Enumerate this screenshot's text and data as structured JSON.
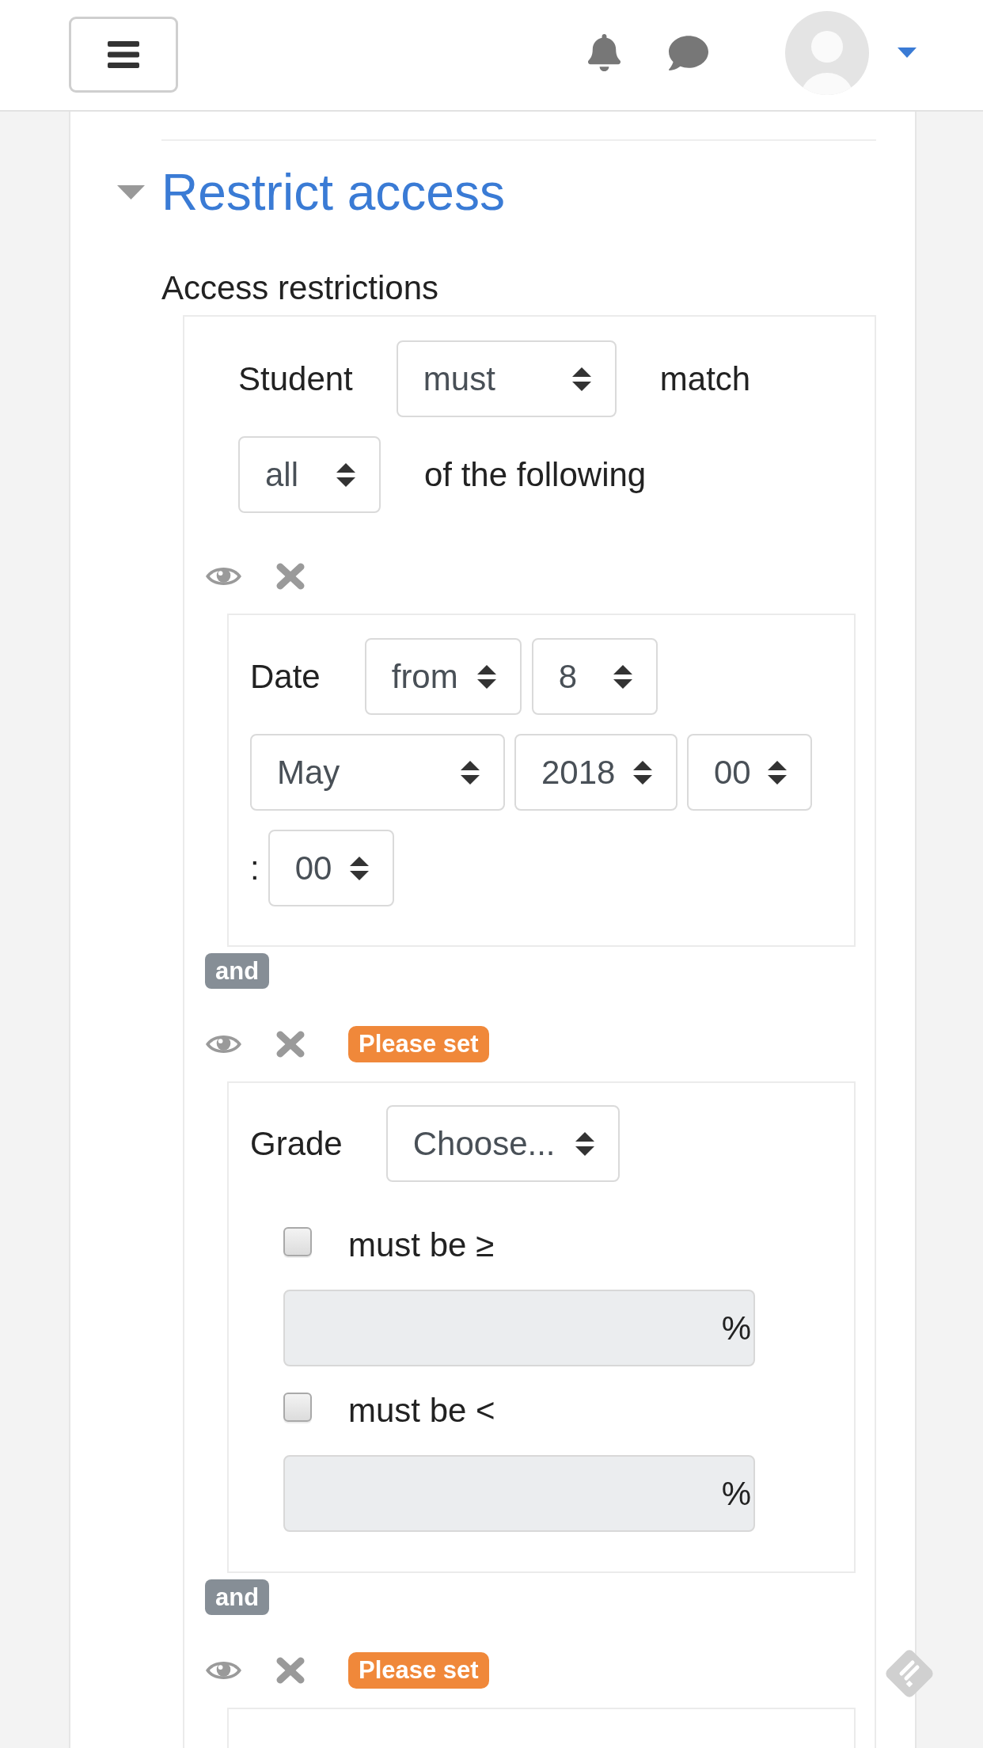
{
  "section": {
    "title": "Restrict access",
    "expanded": true
  },
  "restrictions": {
    "label": "Access restrictions",
    "match_row": {
      "prefix": "Student",
      "select": "must",
      "suffix": "match"
    },
    "scope_row": {
      "select": "all",
      "suffix": "of the following"
    },
    "conditions": [
      {
        "kind": "date",
        "label": "Date",
        "direction": "from",
        "day": "8",
        "month": "May",
        "year": "2018",
        "hour": "00",
        "separator": ":",
        "minute": "00",
        "joiner": "and"
      },
      {
        "kind": "grade",
        "warning": "Please set",
        "label": "Grade",
        "select": "Choose...",
        "bounds": [
          {
            "label": "must be ≥",
            "checked": false,
            "unit": "%"
          },
          {
            "label": "must be <",
            "checked": false,
            "unit": "%"
          }
        ],
        "joiner": "and"
      },
      {
        "kind": "other",
        "warning": "Please set"
      }
    ]
  }
}
